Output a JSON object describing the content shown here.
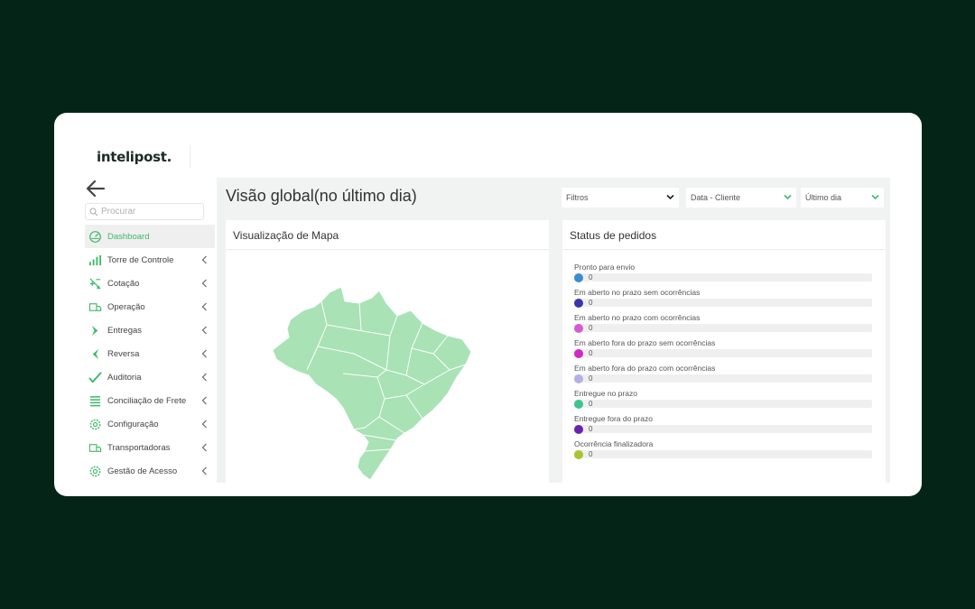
{
  "brand": {
    "logo_text": "intelipost."
  },
  "sidebar": {
    "search_placeholder": "Procurar",
    "items": [
      {
        "label": "Dashboard",
        "icon": "dashboard-icon",
        "active": true
      },
      {
        "label": "Torre de Controle",
        "icon": "bar-chart-icon"
      },
      {
        "label": "Cotação",
        "icon": "calculator-icon"
      },
      {
        "label": "Operação",
        "icon": "truck-icon"
      },
      {
        "label": "Entregas",
        "icon": "chevron-right-icon"
      },
      {
        "label": "Reversa",
        "icon": "chevron-left-icon"
      },
      {
        "label": "Auditoria",
        "icon": "check-icon"
      },
      {
        "label": "Conciliação de Frete",
        "icon": "list-icon"
      },
      {
        "label": "Configuração",
        "icon": "gear-icon"
      },
      {
        "label": "Transportadoras",
        "icon": "truck-icon"
      },
      {
        "label": "Gestão de Acesso",
        "icon": "gear-icon"
      }
    ]
  },
  "header": {
    "title": "Visão global(no último dia)",
    "filters": [
      {
        "label": "Filtros"
      },
      {
        "label": "Data - Cliente"
      },
      {
        "label": "Último dia"
      }
    ]
  },
  "map_panel": {
    "title": "Visualização de Mapa"
  },
  "status_panel": {
    "title": "Status de pedidos",
    "items": [
      {
        "label": "Pronto para envio",
        "value": "0",
        "color": "#3a8ed0"
      },
      {
        "label": "Em aberto no prazo sem ocorrências",
        "value": "0",
        "color": "#3a34b0"
      },
      {
        "label": "Em aberto no prazo com ocorrências",
        "value": "0",
        "color": "#d65ad3"
      },
      {
        "label": "Em aberto fora do prazo sem ocorrências",
        "value": "0",
        "color": "#d028c6"
      },
      {
        "label": "Em aberto fora do prazo com ocorrências",
        "value": "0",
        "color": "#b4b0e6"
      },
      {
        "label": "Entregue no prazo",
        "value": "0",
        "color": "#3cc58c"
      },
      {
        "label": "Entregue fora do prazo",
        "value": "0",
        "color": "#6a22b0"
      },
      {
        "label": "Ocorrência finalizadora",
        "value": "0",
        "color": "#a8c431"
      }
    ]
  },
  "colors": {
    "accent": "#3db86b",
    "map_fill": "#a8e2b5",
    "background": "#032417"
  }
}
